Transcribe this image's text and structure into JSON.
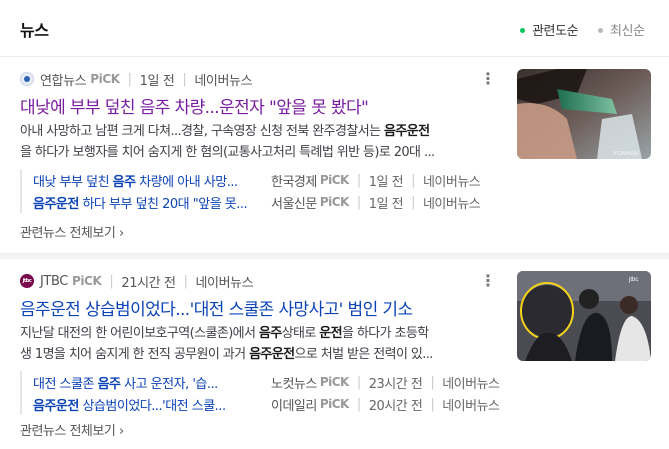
{
  "header": {
    "title": "뉴스",
    "sort_relevance": "관련도순",
    "sort_latest": "최신순"
  },
  "articles": [
    {
      "source": "연합뉴스",
      "pick": "PiCK",
      "time": "1일 전",
      "naver": "네이버뉴스",
      "title": "대낮에 부부 덮친 음주 차량...운전자 \"앞을 못 봤다\"",
      "desc1": [
        "아내 사망하고 남편 크게 다쳐...경찰, 구속영장 신청 전북 완주경찰서는 ",
        "음주운전"
      ],
      "desc2": [
        "을 하다가 보행자를 치어 숨지게 한 혐의(교통사고처리 특례법 위반 등)로 20대 ..."
      ],
      "related": [
        {
          "title_pre": "대낮 부부 덮친 ",
          "title_bold": "음주",
          "title_post": " 차량에 아내 사망...",
          "source": "한국경제",
          "pick": "PiCK",
          "time": "1일 전",
          "naver": "네이버뉴스"
        },
        {
          "title_pre": "",
          "title_bold": "음주운전",
          "title_post": " 하다 부부 덮친 20대 \"앞을 못...",
          "source": "서울신문",
          "pick": "PiCK",
          "time": "1일 전",
          "naver": "네이버뉴스"
        }
      ],
      "all_related": "관련뉴스 전체보기"
    },
    {
      "source": "JTBC",
      "pick": "PiCK",
      "time": "21시간 전",
      "naver": "네이버뉴스",
      "title": "음주운전 상습범이었다...'대전 스쿨존 사망사고' 범인 기소",
      "desc1": [
        "지난달 대전의 한 어린이보호구역(스쿨존)에서 ",
        "음주",
        "상태로 ",
        "운전",
        "을 하다가 초등학"
      ],
      "desc2": [
        "생 1명을 치어 숨지게 한 전직 공무원이 과거 ",
        "음주운전",
        "으로 처벌 받은 전력이 있..."
      ],
      "related": [
        {
          "title_pre": "대전 스쿨존 ",
          "title_bold": "음주",
          "title_post": " 사고 운전자, '습...",
          "source": "노컷뉴스",
          "pick": "PiCK",
          "time": "23시간 전",
          "naver": "네이버뉴스"
        },
        {
          "title_pre": "",
          "title_bold": "음주운전",
          "title_post": " 상습범이었다...'대전 스쿨...",
          "source": "이데일리",
          "pick": "PiCK",
          "time": "20시간 전",
          "naver": "네이버뉴스"
        }
      ],
      "all_related": "관련뉴스 전체보기"
    }
  ],
  "watermark": "YONHAP",
  "jtbc_logo_text": "jtbc",
  "colors": {
    "visited": "#7a1ea1",
    "link": "#0c43b7",
    "green_dot": "#03c75a"
  }
}
